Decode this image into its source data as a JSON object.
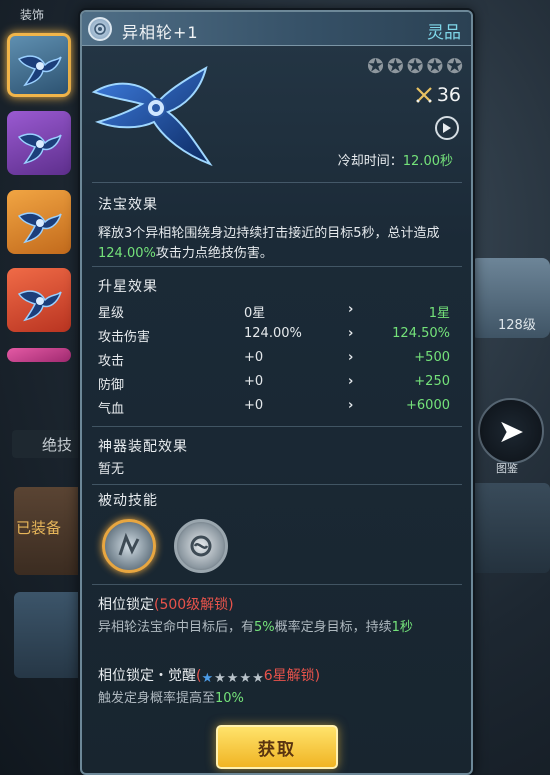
{
  "background": {
    "top_label": "装饰",
    "tab_label": "绝技",
    "card_label": "已装备",
    "right_level": "128级",
    "right_button_label": "图鉴"
  },
  "item": {
    "name": "异相轮+1",
    "grade": "灵品",
    "stars_total": 5,
    "stars_filled": 0,
    "power": "36",
    "cooldown_label": "冷却时间：",
    "cooldown_value": "12.00秒"
  },
  "effect": {
    "title": "法宝效果",
    "text_before": "释放3个异相轮围绕身边持续打击接近的目标5秒，总计造成",
    "highlight": "124.00%",
    "text_after": "攻击力点绝技伤害。"
  },
  "upgrade": {
    "title": "升星效果",
    "rows": [
      {
        "label": "星级",
        "current": "0星",
        "next": "1星"
      },
      {
        "label": "攻击伤害",
        "current": "124.00%",
        "next": "124.50%"
      },
      {
        "label": "攻击",
        "current": "+0",
        "next": "+500"
      },
      {
        "label": "防御",
        "current": "+0",
        "next": "+250"
      },
      {
        "label": "气血",
        "current": "+0",
        "next": "+6000"
      }
    ],
    "arrow": "›"
  },
  "artifact": {
    "title": "神器装配效果",
    "value": "暂无"
  },
  "passive": {
    "title": "被动技能"
  },
  "lock1": {
    "title": "相位锁定",
    "unlock": "(500级解锁)",
    "text_a": "异相轮法宝命中目标后，有",
    "pct": "5%",
    "text_b": "概率定身目标，持续",
    "dur": "1秒"
  },
  "lock2": {
    "title": "相位锁定・觉醒",
    "unlock_open": "(",
    "unlock_close": "6星解锁)",
    "text_a": "触发定身概率提高至",
    "pct": "10%"
  },
  "button": {
    "label": "获取"
  },
  "colors": {
    "green": "#74e27a",
    "red": "#e8534b",
    "grade": "#7fd6e8",
    "button": "#f0b424"
  }
}
